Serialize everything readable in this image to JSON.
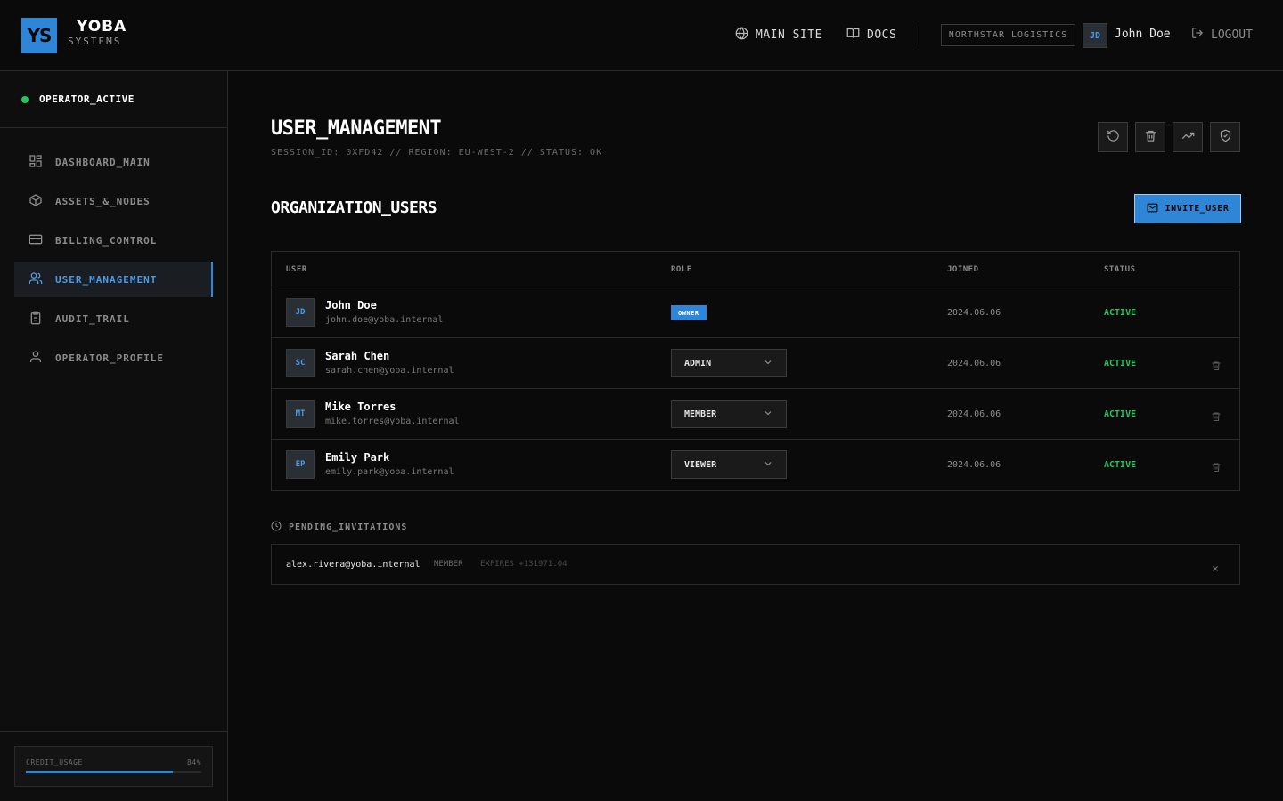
{
  "brand": {
    "logo": "YS",
    "name": "YOBA",
    "sub": "SYSTEMS",
    "accent": "#2f86d6"
  },
  "header": {
    "main_site": "MAIN SITE",
    "docs": "DOCS",
    "org": "NORTHSTAR LOGISTICS",
    "user_initials": "JD",
    "user_name": "John Doe",
    "logout": "LOGOUT"
  },
  "sidebar": {
    "status": "OPERATOR_ACTIVE",
    "items": [
      {
        "label": "DASHBOARD_MAIN",
        "icon": "grid-icon"
      },
      {
        "label": "ASSETS_&_NODES",
        "icon": "cube-icon"
      },
      {
        "label": "BILLING_CONTROL",
        "icon": "card-icon"
      },
      {
        "label": "USER_MANAGEMENT",
        "icon": "users-icon",
        "active": true
      },
      {
        "label": "AUDIT_TRAIL",
        "icon": "clipboard-icon"
      },
      {
        "label": "OPERATOR_PROFILE",
        "icon": "user-icon"
      }
    ],
    "credit": {
      "label": "CREDIT_USAGE",
      "value": "84%",
      "fraction": 0.84
    }
  },
  "page": {
    "title": "USER_MANAGEMENT",
    "session": "SESSION_ID: 0XFD42 // REGION: EU-WEST-2 // STATUS: OK",
    "section_title": "ORGANIZATION_USERS",
    "invite_label": "INVITE_USER"
  },
  "table": {
    "headers": {
      "user": "USER",
      "role": "ROLE",
      "joined": "JOINED",
      "status": "STATUS"
    },
    "rows": [
      {
        "initials": "JD",
        "name": "John Doe",
        "email": "john.doe@yoba.internal",
        "role": "OWNER",
        "joined": "2024.06.06",
        "status": "ACTIVE"
      },
      {
        "initials": "SC",
        "name": "Sarah Chen",
        "email": "sarah.chen@yoba.internal",
        "role": "ADMIN",
        "joined": "2024.06.06",
        "status": "ACTIVE"
      },
      {
        "initials": "MT",
        "name": "Mike Torres",
        "email": "mike.torres@yoba.internal",
        "role": "MEMBER",
        "joined": "2024.06.06",
        "status": "ACTIVE"
      },
      {
        "initials": "EP",
        "name": "Emily Park",
        "email": "emily.park@yoba.internal",
        "role": "VIEWER",
        "joined": "2024.06.06",
        "status": "ACTIVE"
      }
    ]
  },
  "pending": {
    "title": "PENDING_INVITATIONS",
    "items": [
      {
        "email": "alex.rivera@yoba.internal",
        "role": "MEMBER",
        "expires": "EXPIRES +131971.04"
      }
    ]
  }
}
